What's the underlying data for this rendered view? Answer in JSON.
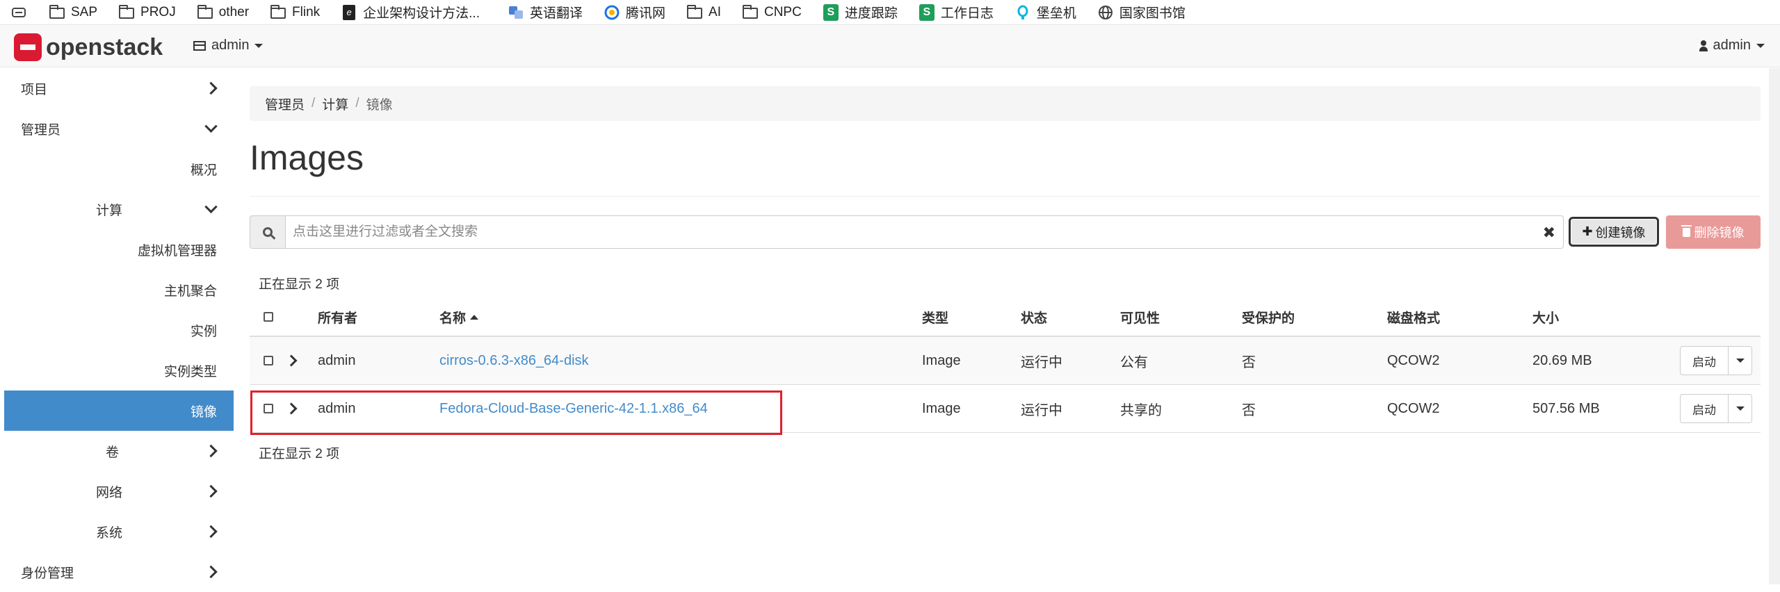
{
  "bookmarks": [
    {
      "label": "SAP",
      "icon": "folder-icon"
    },
    {
      "label": "PROJ",
      "icon": "folder-icon"
    },
    {
      "label": "other",
      "icon": "folder-icon"
    },
    {
      "label": "Flink",
      "icon": "folder-icon"
    },
    {
      "label": "企业架构设计方法...",
      "icon": "book-icon"
    },
    {
      "label": "英语翻译",
      "icon": "translate-icon"
    },
    {
      "label": "腾讯网",
      "icon": "tencent-icon"
    },
    {
      "label": "AI",
      "icon": "folder-icon"
    },
    {
      "label": "CNPC",
      "icon": "folder-icon"
    },
    {
      "label": "进度跟踪",
      "icon": "sheet-icon",
      "badge": "S"
    },
    {
      "label": "工作日志",
      "icon": "sheet-icon",
      "badge": "S"
    },
    {
      "label": "堡垒机",
      "icon": "bastion-icon"
    },
    {
      "label": "国家图书馆",
      "icon": "globe-icon"
    }
  ],
  "navbar": {
    "logo_text": "openstack",
    "project_label": "admin",
    "user_label": "admin"
  },
  "sidebar": {
    "items": [
      {
        "label": "项目",
        "level": 0,
        "chevron": "right"
      },
      {
        "label": "管理员",
        "level": 0,
        "chevron": "down"
      },
      {
        "label": "概况",
        "level": 1
      },
      {
        "label": "计算",
        "level": 1,
        "chevron": "down"
      },
      {
        "label": "虚拟机管理器",
        "level": 2
      },
      {
        "label": "主机聚合",
        "level": 2
      },
      {
        "label": "实例",
        "level": 2
      },
      {
        "label": "实例类型",
        "level": 2
      },
      {
        "label": "镜像",
        "level": 2,
        "active": true
      },
      {
        "label": "卷",
        "level": 1,
        "chevron": "right"
      },
      {
        "label": "网络",
        "level": 1,
        "chevron": "right"
      },
      {
        "label": "系统",
        "level": 1,
        "chevron": "right"
      },
      {
        "label": "身份管理",
        "level": 0,
        "chevron": "right"
      }
    ]
  },
  "breadcrumb": {
    "items": [
      "管理员",
      "计算"
    ],
    "current": "镜像"
  },
  "page": {
    "title": "Images"
  },
  "search": {
    "placeholder": "点击这里进行过滤或者全文搜索",
    "value": ""
  },
  "actions": {
    "create_label": "创建镜像",
    "delete_label": "删除镜像"
  },
  "table": {
    "count_text": "正在显示 2 项",
    "headers": [
      "所有者",
      "名称",
      "类型",
      "状态",
      "可见性",
      "受保护的",
      "磁盘格式",
      "大小"
    ],
    "sorted_column": "名称",
    "rows": [
      {
        "owner": "admin",
        "name": "cirros-0.6.3-x86_64-disk",
        "type": "Image",
        "status": "运行中",
        "visibility": "公有",
        "protected": "否",
        "format": "QCOW2",
        "size": "20.69 MB",
        "action": "启动"
      },
      {
        "owner": "admin",
        "name": "Fedora-Cloud-Base-Generic-42-1.1.x86_64",
        "type": "Image",
        "status": "运行中",
        "visibility": "共享的",
        "protected": "否",
        "format": "QCOW2",
        "size": "507.56 MB",
        "action": "启动"
      }
    ]
  },
  "colors": {
    "accent": "#428bca",
    "danger": "#e89a98",
    "highlight": "#e0212b",
    "brand": "#da1a32"
  }
}
